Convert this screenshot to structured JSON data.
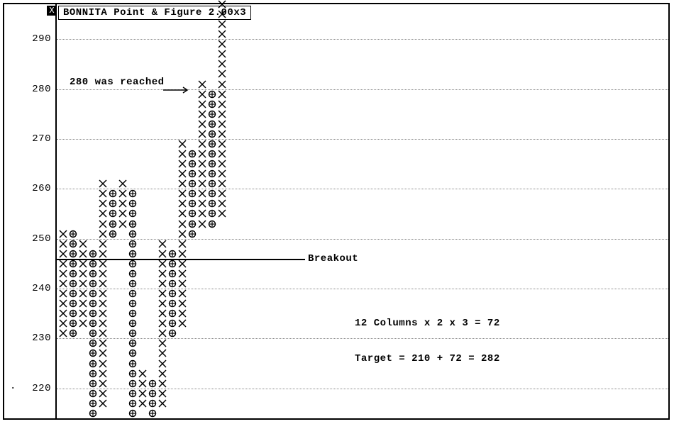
{
  "chart_data": {
    "type": "point_and_figure",
    "title": "BONNITA Point & Figure 2.00x3",
    "box_size": 2.0,
    "reversal": 3,
    "y_axis": {
      "ticks": [
        220,
        230,
        240,
        250,
        260,
        270,
        280,
        290
      ],
      "min": 214,
      "max": 297
    },
    "annotations": {
      "reached": "280 was reached",
      "breakout_label": "Breakout",
      "columns_calc": "12 Columns x 2 x 3 = 72",
      "target_calc": "Target = 210 + 72 = 282"
    },
    "breakout_level": 246,
    "columns": [
      {
        "dir": "X",
        "low": 230,
        "high": 251
      },
      {
        "dir": "O",
        "low": 230,
        "high": 250
      },
      {
        "dir": "X",
        "low": 232,
        "high": 248
      },
      {
        "dir": "O",
        "low": 214,
        "high": 246
      },
      {
        "dir": "X",
        "low": 216,
        "high": 261
      },
      {
        "dir": "O",
        "low": 250,
        "high": 258
      },
      {
        "dir": "X",
        "low": 252,
        "high": 261
      },
      {
        "dir": "O",
        "low": 214,
        "high": 258
      },
      {
        "dir": "X",
        "low": 216,
        "high": 222
      },
      {
        "dir": "O",
        "low": 214,
        "high": 220
      },
      {
        "dir": "X",
        "low": 216,
        "high": 248
      },
      {
        "dir": "O",
        "low": 230,
        "high": 246
      },
      {
        "dir": "X",
        "low": 232,
        "high": 269
      },
      {
        "dir": "O",
        "low": 250,
        "high": 266
      },
      {
        "dir": "X",
        "low": 252,
        "high": 281
      },
      {
        "dir": "O",
        "low": 252,
        "high": 278
      },
      {
        "dir": "X",
        "low": 254,
        "high": 296
      }
    ]
  }
}
